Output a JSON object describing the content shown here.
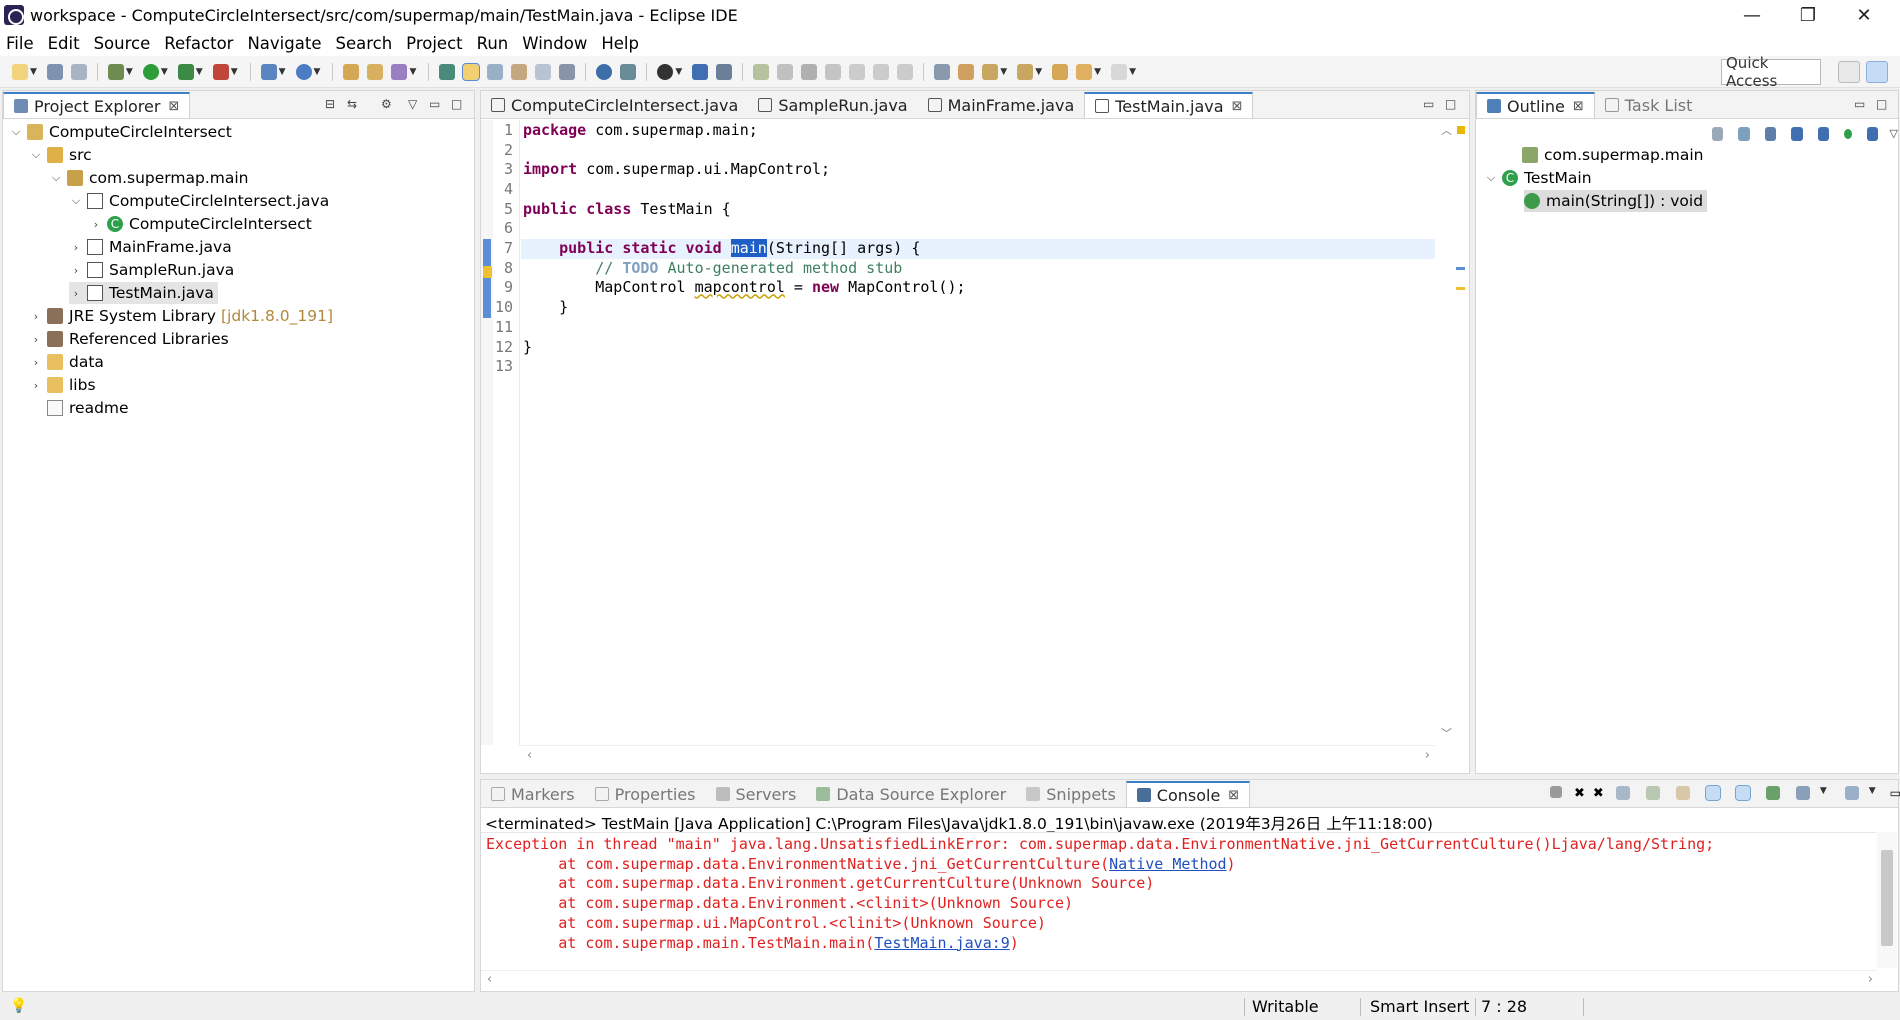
{
  "window": {
    "title": "workspace - ComputeCircleIntersect/src/com/supermap/main/TestMain.java - Eclipse IDE",
    "minimize": "—",
    "restore": "❐",
    "close": "✕"
  },
  "menu": [
    "File",
    "Edit",
    "Source",
    "Refactor",
    "Navigate",
    "Search",
    "Project",
    "Run",
    "Window",
    "Help"
  ],
  "toolbar": {
    "quick_access": "Quick Access"
  },
  "project_explorer": {
    "tab_label": "Project Explorer",
    "items": [
      {
        "label": "ComputeCircleIntersect",
        "icon": "project-icon"
      },
      {
        "label": "src",
        "icon": "source-folder-icon"
      },
      {
        "label": "com.supermap.main",
        "icon": "package-icon"
      },
      {
        "label": "ComputeCircleIntersect.java",
        "icon": "java-file-icon"
      },
      {
        "label": "ComputeCircleIntersect",
        "icon": "class-icon"
      },
      {
        "label": "MainFrame.java",
        "icon": "java-file-icon"
      },
      {
        "label": "SampleRun.java",
        "icon": "java-file-icon"
      },
      {
        "label": "TestMain.java",
        "icon": "java-file-icon"
      },
      {
        "label": "JRE System Library",
        "extra": "[jdk1.8.0_191]",
        "icon": "library-icon"
      },
      {
        "label": "Referenced Libraries",
        "icon": "library-icon"
      },
      {
        "label": "data",
        "icon": "folder-icon"
      },
      {
        "label": "libs",
        "icon": "folder-icon"
      },
      {
        "label": "readme",
        "icon": "file-icon"
      }
    ]
  },
  "editor": {
    "tabs": [
      {
        "label": "ComputeCircleIntersect.java"
      },
      {
        "label": "SampleRun.java"
      },
      {
        "label": "MainFrame.java"
      },
      {
        "label": "TestMain.java",
        "active": true
      }
    ],
    "line_numbers": [
      "1",
      "2",
      "3",
      "4",
      "5",
      "6",
      "7",
      "8",
      "9",
      "10",
      "11",
      "12",
      "13"
    ],
    "code": {
      "l1_kw": "package",
      "l1_rest": " com.supermap.main;",
      "l3_kw": "import",
      "l3_rest": " com.supermap.ui.MapControl;",
      "l5_kw": "public class",
      "l5_rest": " TestMain {",
      "l7_indent": "    ",
      "l7_kw": "public static void",
      "l7_sp": " ",
      "l7_hl": "main",
      "l7_rest": "(String[] args) {",
      "l8_indent": "        ",
      "l8_cm1": "// ",
      "l8_todo": "TODO",
      "l8_cm2": " Auto-generated method stub",
      "l9_indent": "        ",
      "l9_a": "MapControl ",
      "l9_var": "mapcontrol",
      "l9_b": " = ",
      "l9_kw": "new",
      "l9_c": " MapControl();",
      "l10": "    }",
      "l12": "}"
    }
  },
  "outline": {
    "tabs": [
      {
        "label": "Outline",
        "active": true
      },
      {
        "label": "Task List"
      }
    ],
    "items": [
      {
        "label": "com.supermap.main",
        "icon": "package-icon"
      },
      {
        "label": "TestMain",
        "icon": "class-icon"
      },
      {
        "label": "main(String[]) : void",
        "icon": "method-icon",
        "selected": true
      }
    ]
  },
  "console": {
    "tabs": [
      {
        "label": "Markers"
      },
      {
        "label": "Properties"
      },
      {
        "label": "Servers"
      },
      {
        "label": "Data Source Explorer"
      },
      {
        "label": "Snippets"
      },
      {
        "label": "Console",
        "active": true
      }
    ],
    "header": "<terminated> TestMain [Java Application] C:\\Program Files\\Java\\jdk1.8.0_191\\bin\\javaw.exe (2019年3月26日 上午11:18:00)",
    "lines": {
      "l1": "Exception in thread \"main\" java.lang.UnsatisfiedLinkError: com.supermap.data.EnvironmentNative.jni_GetCurrentCulture()Ljava/lang/String;",
      "l2a": "\tat com.supermap.data.EnvironmentNative.jni_GetCurrentCulture(",
      "l2link": "Native Method",
      "l2b": ")",
      "l3": "\tat com.supermap.data.Environment.getCurrentCulture(Unknown Source)",
      "l4": "\tat com.supermap.data.Environment.<clinit>(Unknown Source)",
      "l5": "\tat com.supermap.ui.MapControl.<clinit>(Unknown Source)",
      "l6a": "\tat com.supermap.main.TestMain.main(",
      "l6link": "TestMain.java:9",
      "l6b": ")"
    }
  },
  "status": {
    "writable": "Writable",
    "insert_mode": "Smart Insert",
    "position": "7 : 28"
  }
}
